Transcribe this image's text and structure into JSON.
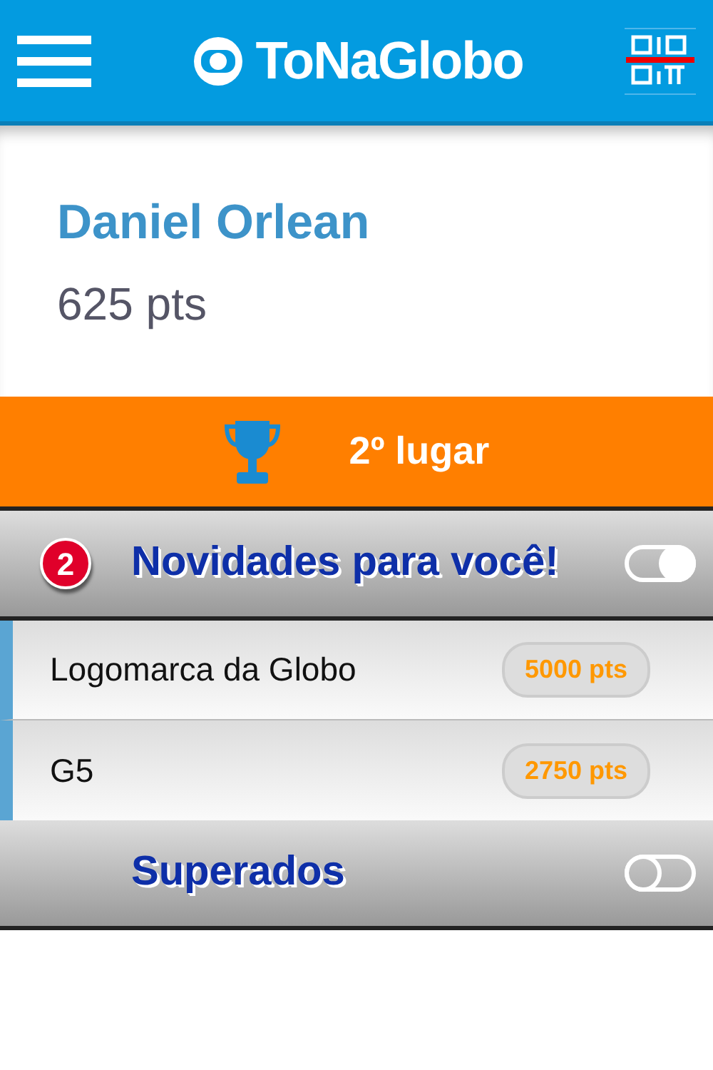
{
  "header": {
    "logo": "ToNaGlobo"
  },
  "profile": {
    "name": "Daniel Orlean",
    "points": "625 pts"
  },
  "rank": {
    "label": "2º lugar"
  },
  "sections": [
    {
      "title": "Novidades para você!",
      "badge": "2",
      "on": true,
      "items": [
        {
          "name": "Logomarca da Globo",
          "points": "5000 pts"
        },
        {
          "name": "G5",
          "points": "2750 pts"
        }
      ]
    },
    {
      "title": "Superados",
      "on": false
    }
  ]
}
